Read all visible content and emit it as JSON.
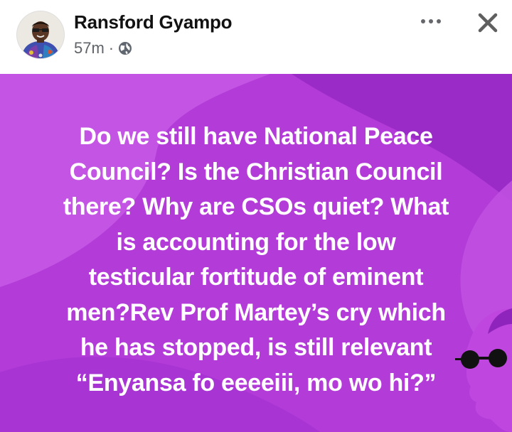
{
  "post": {
    "author": "Ransford Gyampo",
    "time": "57m",
    "separator": "·",
    "privacy_icon": "globe-icon",
    "more_icon": "more-horizontal-icon",
    "close_icon": "close-icon",
    "body": "Do we still have National Peace\nCouncil? Is the Christian Council\nthere? Why are CSOs quiet? What\nis accounting for the low\ntesticular fortitude of eminent\nmen?Rev Prof Martey’s cry which\nhe has stopped, is still relevant\n“Enyansa fo eeeeiii, mo wo hi?”",
    "background_colors": {
      "base": "#b33bd8",
      "light": "#c85de6",
      "dark": "#9d2ec7"
    }
  }
}
